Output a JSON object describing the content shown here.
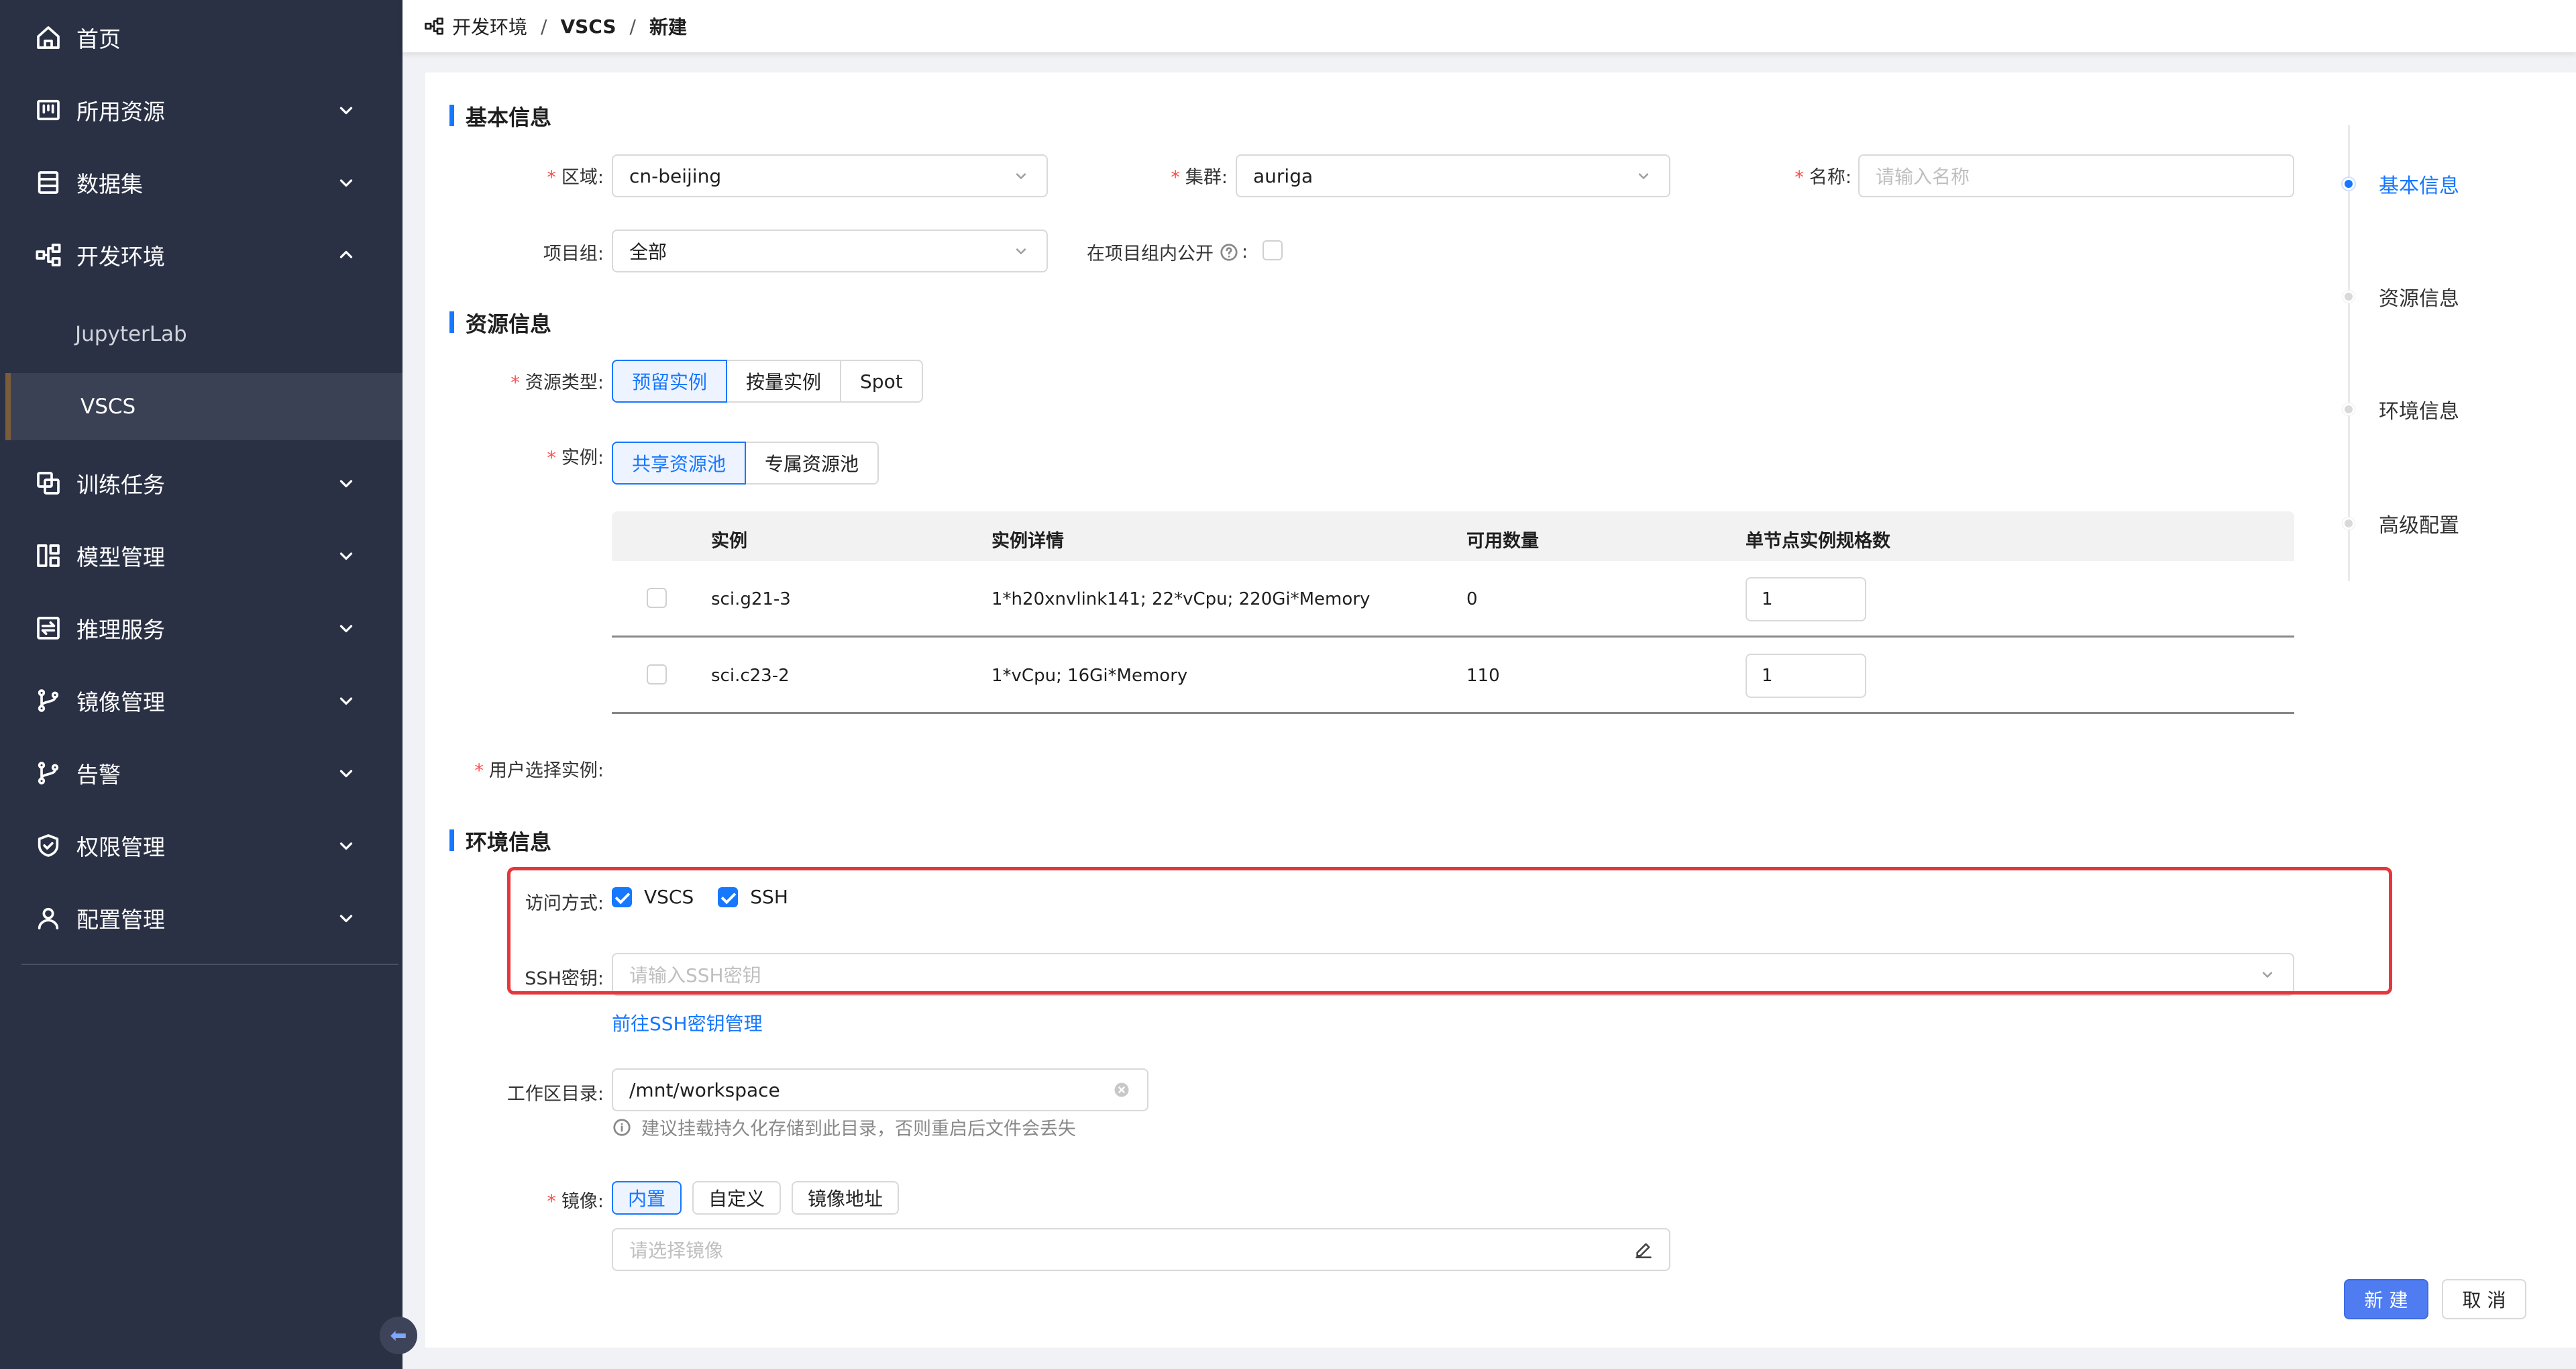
{
  "sidebar": {
    "items": [
      {
        "label": "首页",
        "icon": "home-icon"
      },
      {
        "label": "所用资源",
        "icon": "resource-icon"
      },
      {
        "label": "数据集",
        "icon": "dataset-icon"
      },
      {
        "label": "开发环境",
        "icon": "devenv-icon"
      },
      {
        "label": "训练任务",
        "icon": "training-icon"
      },
      {
        "label": "模型管理",
        "icon": "model-icon"
      },
      {
        "label": "推理服务",
        "icon": "inference-icon"
      },
      {
        "label": "镜像管理",
        "icon": "branch-icon"
      },
      {
        "label": "告警",
        "icon": "branch-icon"
      },
      {
        "label": "权限管理",
        "icon": "shield-icon"
      },
      {
        "label": "配置管理",
        "icon": "user-icon"
      }
    ],
    "sub_items": [
      "JupyterLab",
      "VSCS"
    ],
    "active_sub": "VSCS"
  },
  "breadcrumb": {
    "items": [
      "开发环境",
      "VSCS",
      "新建"
    ],
    "separator": "/"
  },
  "basic": {
    "title": "基本信息",
    "region_label": "区域",
    "region_value": "cn-beijing",
    "cluster_label": "集群",
    "cluster_value": "auriga",
    "name_label": "名称",
    "name_placeholder": "请输入名称",
    "project_label": "项目组",
    "project_value": "全部",
    "public_label": "在项目组内公开"
  },
  "resource": {
    "title": "资源信息",
    "type_label": "资源类型",
    "type_options": [
      "预留实例",
      "按量实例",
      "Spot"
    ],
    "type_selected": "预留实例",
    "instance_label": "实例",
    "pool_options": [
      "共享资源池",
      "专属资源池"
    ],
    "pool_selected": "共享资源池",
    "table": {
      "columns": [
        "实例",
        "实例详情",
        "可用数量",
        "单节点实例规格数"
      ],
      "rows": [
        {
          "name": "sci.g21-3",
          "detail": "1*h20xnvlink141; 22*vCpu; 220Gi*Memory",
          "available": "0",
          "spec": "1"
        },
        {
          "name": "sci.c23-2",
          "detail": "1*vCpu; 16Gi*Memory",
          "available": "110",
          "spec": "1"
        }
      ]
    },
    "user_select_label": "用户选择实例"
  },
  "env": {
    "title": "环境信息",
    "access_label": "访问方式",
    "access_options": [
      "VSCS",
      "SSH"
    ],
    "ssh_label": "SSH密钥",
    "ssh_placeholder": "请输入SSH密钥",
    "ssh_link": "前往SSH密钥管理",
    "workdir_label": "工作区目录",
    "workdir_value": "/mnt/workspace",
    "workdir_hint": "建议挂载持久化存储到此目录，否则重启后文件会丢失",
    "image_label": "镜像",
    "image_options": [
      "内置",
      "自定义",
      "镜像地址"
    ],
    "image_selected": "内置",
    "image_placeholder": "请选择镜像"
  },
  "anchor": [
    "基本信息",
    "资源信息",
    "环境信息",
    "高级配置"
  ],
  "anchor_active": "基本信息",
  "actions": {
    "create": "新 建",
    "cancel": "取 消"
  },
  "colors": {
    "sidebar_bg": "#2b3145",
    "primary": "#1677ff",
    "highlight": "#e5373b"
  }
}
